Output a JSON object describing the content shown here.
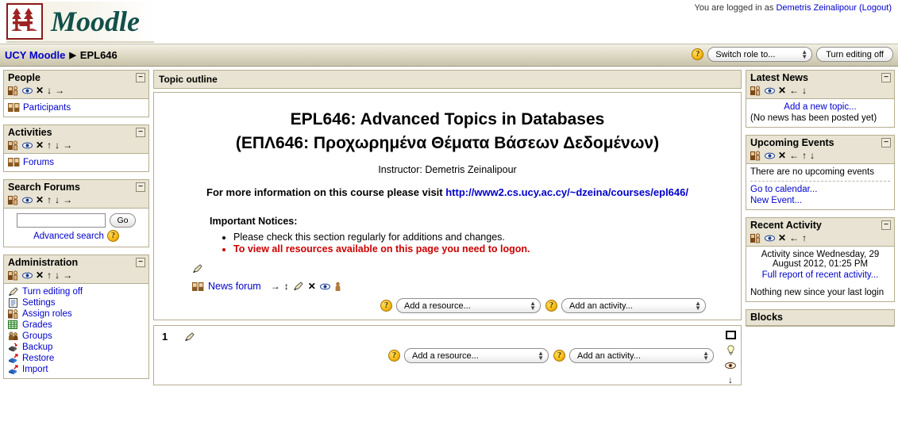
{
  "header": {
    "logo_text": "Moodle",
    "logo_icon": "moodle-trees-logo",
    "login_prefix": "You are logged in as",
    "user_name": "Demetris Zeinalipour",
    "logout_label": "(Logout)"
  },
  "navbar": {
    "breadcrumb": [
      {
        "label": "UCY Moodle",
        "link": true
      },
      {
        "label": "EPL646",
        "link": false
      }
    ],
    "separator": "▶",
    "help_icon": "help-icon",
    "switch_role_value": "Switch role to...",
    "editing_button": "Turn editing off"
  },
  "left_blocks": [
    {
      "title": "People",
      "collapse_icon": "−",
      "edit_icons": [
        "assign-roles-icon",
        "hide-icon",
        "delete-icon",
        "move-down-icon",
        "move-right-icon"
      ],
      "items": [
        {
          "label": "Participants",
          "icon": "users-icon"
        }
      ]
    },
    {
      "title": "Activities",
      "collapse_icon": "−",
      "edit_icons": [
        "assign-roles-icon",
        "hide-icon",
        "delete-icon",
        "move-up-icon",
        "move-down-icon",
        "move-right-icon"
      ],
      "items": [
        {
          "label": "Forums",
          "icon": "forum-icon"
        }
      ]
    },
    {
      "title": "Search Forums",
      "collapse_icon": "−",
      "edit_icons": [
        "assign-roles-icon",
        "hide-icon",
        "delete-icon",
        "move-up-icon",
        "move-down-icon",
        "move-right-icon"
      ],
      "search_value": "",
      "search_placeholder": "",
      "go_label": "Go",
      "advanced_label": "Advanced search"
    },
    {
      "title": "Administration",
      "collapse_icon": "−",
      "edit_icons": [
        "assign-roles-icon",
        "hide-icon",
        "delete-icon",
        "move-up-icon",
        "move-down-icon",
        "move-right-icon"
      ],
      "items": [
        {
          "label": "Turn editing off",
          "icon": "pencil-icon"
        },
        {
          "label": "Settings",
          "icon": "settings-icon"
        },
        {
          "label": "Assign roles",
          "icon": "assign-roles-icon"
        },
        {
          "label": "Grades",
          "icon": "grades-icon"
        },
        {
          "label": "Groups",
          "icon": "groups-icon"
        },
        {
          "label": "Backup",
          "icon": "backup-icon"
        },
        {
          "label": "Restore",
          "icon": "restore-icon"
        },
        {
          "label": "Import",
          "icon": "import-icon"
        }
      ]
    }
  ],
  "center": {
    "outline_heading": "Topic outline",
    "course_title_en": "EPL646: Advanced Topics in Databases",
    "course_title_gr": "(ΕΠΛ646: Προχωρημένα Θέματα Βάσεων Δεδομένων)",
    "instructor": "Instructor: Demetris Zeinalipour",
    "more_info_text": "For more information on this course please visit ",
    "more_info_url": "http://www2.cs.ucy.ac.cy/~dzeina/courses/epl646/",
    "notices_title": "Important Notices:",
    "notices": [
      {
        "text": "Please check this section regularly for additions and changes.",
        "warn": false
      },
      {
        "text": "To view all resources available on this page you need to logon.",
        "warn": true
      }
    ],
    "news_forum_label": "News forum",
    "news_forum_icon": "forum-icon",
    "news_forum_actions": [
      "move-right-icon",
      "move-updown-icon",
      "edit-icon",
      "delete-icon",
      "hide-icon",
      "groups-icon"
    ],
    "add_resource_value": "Add a resource...",
    "add_activity_value": "Add an activity...",
    "topic_number": "1",
    "side_icons": [
      "highlight-square-icon",
      "lightbulb-icon",
      "eye-icon",
      "move-down-icon"
    ]
  },
  "right_blocks": [
    {
      "title": "Latest News",
      "collapse_icon": "−",
      "edit_icons": [
        "assign-roles-icon",
        "hide-icon",
        "delete-icon",
        "move-left-icon",
        "move-down-icon"
      ],
      "link": "Add a new topic...",
      "body": "(No news has been posted yet)"
    },
    {
      "title": "Upcoming Events",
      "collapse_icon": "−",
      "edit_icons": [
        "assign-roles-icon",
        "hide-icon",
        "delete-icon",
        "move-left-icon",
        "move-up-icon",
        "move-down-icon"
      ],
      "body": "There are no upcoming events",
      "links": [
        "Go to calendar...",
        "New Event..."
      ]
    },
    {
      "title": "Recent Activity",
      "collapse_icon": "−",
      "edit_icons": [
        "assign-roles-icon",
        "hide-icon",
        "delete-icon",
        "move-left-icon",
        "move-up-icon"
      ],
      "activity_since": "Activity since Wednesday, 29 August 2012, 01:25 PM",
      "report_link": "Full report of recent activity...",
      "nothing_new": "Nothing new since your last login"
    },
    {
      "title": "Blocks",
      "collapse_icon": ""
    }
  ],
  "colors": {
    "block_header": "#E8E3D2",
    "block_border": "#B5AE91",
    "link": "#0000CC",
    "warning": "#CC0000",
    "logo_green": "#12504A",
    "logo_red": "#8C1A1A"
  }
}
